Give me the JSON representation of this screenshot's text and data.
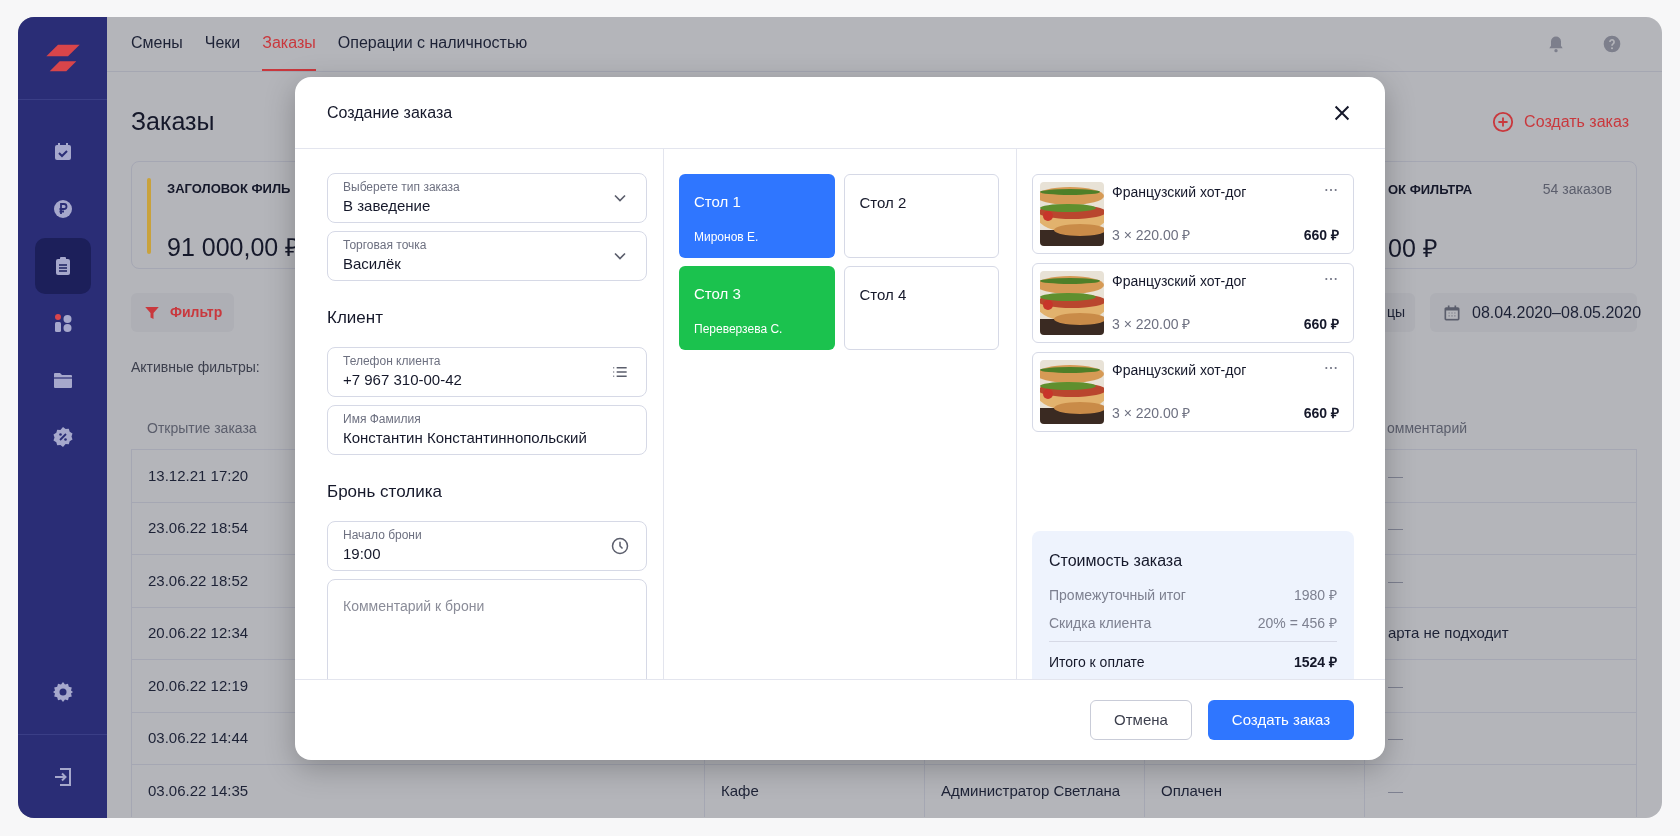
{
  "sidebar": {
    "items": [
      {
        "kind": "calendar",
        "selected": false
      },
      {
        "kind": "ruble",
        "selected": false
      },
      {
        "kind": "clipboard",
        "selected": true
      },
      {
        "kind": "shapes",
        "selected": false
      },
      {
        "kind": "folder",
        "selected": false
      },
      {
        "kind": "percent",
        "selected": false
      }
    ],
    "bottom_items": [
      {
        "kind": "gear"
      },
      {
        "kind": "exit"
      }
    ]
  },
  "top_nav": {
    "tabs": [
      {
        "label": "Смены",
        "selected": false
      },
      {
        "label": "Чеки",
        "selected": false
      },
      {
        "label": "Заказы",
        "selected": true
      },
      {
        "label": "Операции с наличностью",
        "selected": false
      }
    ]
  },
  "page": {
    "title": "Заказы",
    "create_button": "Создать заказ"
  },
  "summary_cards": [
    {
      "title": "ЗАГОЛОВОК ФИЛЬ",
      "amount": "91 000,00 ₽",
      "color": "#c9a23c"
    },
    {
      "title": "ОК ФИЛЬТРА",
      "amount": "00 ₽",
      "count": "54 заказов"
    }
  ],
  "filter_button": "Фильтр",
  "active_filters_label": "Активные фильтры:",
  "period_button": "цы",
  "date_range": "08.04.2020–08.05.2020",
  "table": {
    "columns": [
      "Открытие заказа",
      "омментарий"
    ],
    "rows": [
      {
        "opened": "13.12.21 17:20",
        "comment": "—"
      },
      {
        "opened": "23.06.22 18:54",
        "comment": "—"
      },
      {
        "opened": "23.06.22 18:52",
        "comment": "—"
      },
      {
        "opened": "20.06.22 12:34",
        "comment": "арта не подходит"
      },
      {
        "opened": "20.06.22 12:19",
        "comment": "—"
      },
      {
        "opened": "03.06.22 14:44",
        "comment": "—"
      },
      {
        "opened": "03.06.22 14:35",
        "column_2": "Кафе",
        "column_3": "Администратор Светлана",
        "column_4": "Оплачен",
        "comment": "—"
      }
    ]
  },
  "modal": {
    "title": "Создание заказа",
    "form": [
      {
        "kind": "select",
        "label": "Выберете тип заказа",
        "value": "В заведение"
      },
      {
        "kind": "select",
        "label": "Торговая точка",
        "value": "Василёк"
      },
      {
        "kind": "heading",
        "text": "Клиент"
      },
      {
        "kind": "contact",
        "label": "Телефон клиента",
        "value": "+7 967 310-00-42"
      },
      {
        "kind": "text",
        "label": "Имя Фамилия",
        "value": "Константин Константиннопольский"
      },
      {
        "kind": "heading",
        "text": "Бронь столика"
      },
      {
        "kind": "time",
        "label": "Начало брони",
        "value": "19:00"
      },
      {
        "kind": "textarea",
        "placeholder": "Комментарий к брони"
      }
    ],
    "tables": [
      {
        "name": "Стол 1",
        "guest": "Миронов Е.",
        "color": "#2f76ff"
      },
      {
        "name": "Стол 2"
      },
      {
        "name": "Стол 3",
        "guest": "Переверзева С.",
        "color": "#1bc24e"
      },
      {
        "name": "Стол 4"
      }
    ],
    "items": [
      {
        "name": "Французский хот-дог",
        "qty_price": "3 × 220.00 ₽",
        "total": "660 ₽"
      },
      {
        "name": "Французский хот-дог",
        "qty_price": "3 × 220.00 ₽",
        "total": "660 ₽"
      },
      {
        "name": "Французский хот-дог",
        "qty_price": "3 × 220.00 ₽",
        "total": "660 ₽"
      }
    ],
    "summary": {
      "title": "Стоимость заказа",
      "lines": [
        {
          "label": "Промежуточный итог",
          "value": "1980 ₽"
        },
        {
          "label": "Скидка клиента",
          "value": "20% = 456 ₽"
        }
      ],
      "total": {
        "label": "Итого к оплате",
        "value": "1524 ₽"
      }
    },
    "buttons": [
      {
        "kind": "secondary",
        "label": "Отмена"
      },
      {
        "kind": "primary",
        "label": "Создать заказ"
      }
    ]
  }
}
